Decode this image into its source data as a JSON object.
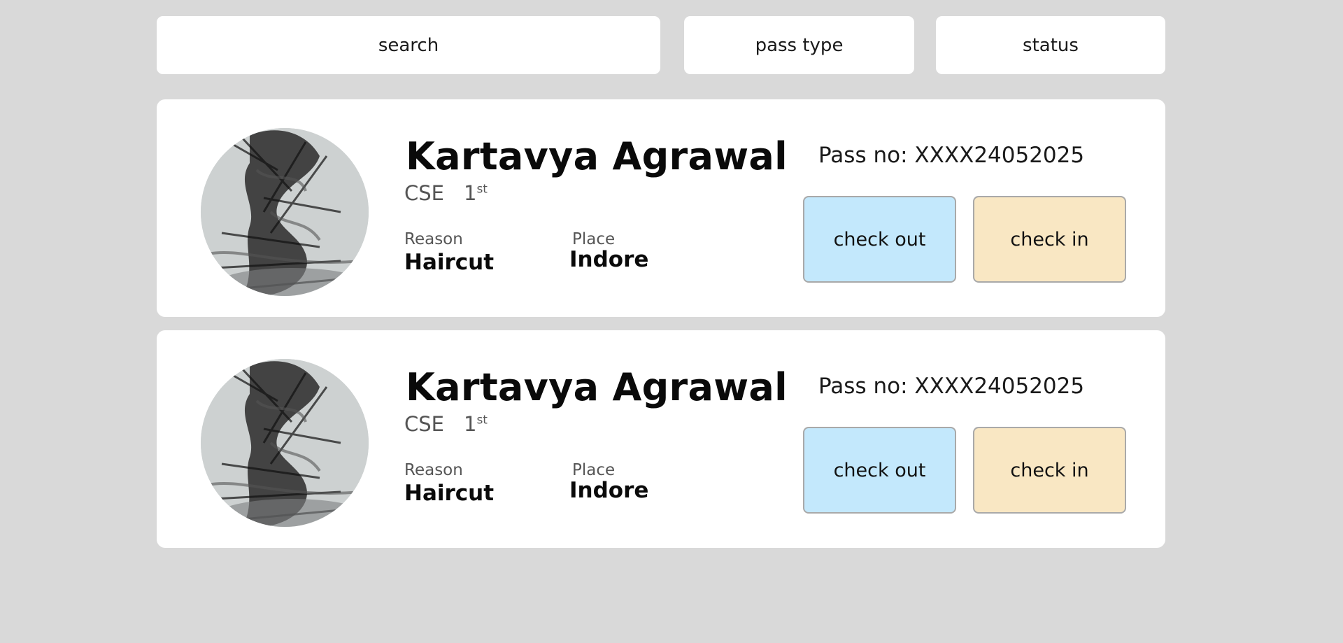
{
  "filters": {
    "search_label": "search",
    "pass_type_label": "pass type",
    "status_label": "status"
  },
  "passes": [
    {
      "name": "Kartavya Agrawal",
      "branch": "CSE",
      "year_number": "1",
      "year_suffix": "st",
      "reason_label": "Reason",
      "reason": "Haircut",
      "place_label": "Place",
      "place": "Indore",
      "pass_no_text": "Pass no: XXXX24052025",
      "checkout_label": "check out",
      "checkin_label": "check in"
    },
    {
      "name": "Kartavya Agrawal",
      "branch": "CSE",
      "year_number": "1",
      "year_suffix": "st",
      "reason_label": "Reason",
      "reason": "Haircut",
      "place_label": "Place",
      "place": "Indore",
      "pass_no_text": "Pass no: XXXX24052025",
      "checkout_label": "check out",
      "checkin_label": "check in"
    }
  ],
  "colors": {
    "background": "#d9d9d9",
    "card": "#ffffff",
    "checkout_button": "#c3e8fc",
    "checkin_button": "#f9e7c3"
  }
}
